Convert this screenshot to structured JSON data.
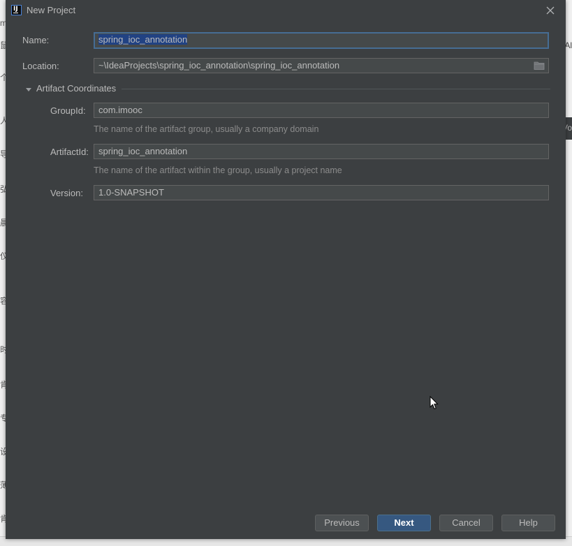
{
  "dialog": {
    "title": "New Project",
    "icon_text": "IJ"
  },
  "form": {
    "name_label": "Name:",
    "name_value": "spring_ioc_annotation",
    "location_label": "Location:",
    "location_value": "~\\IdeaProjects\\spring_ioc_annotation\\spring_ioc_annotation"
  },
  "artifact": {
    "section_title": "Artifact Coordinates",
    "groupid_label": "GroupId:",
    "groupid_value": "com.imooc",
    "groupid_hint": "The name of the artifact group, usually a company domain",
    "artifactid_label": "ArtifactId:",
    "artifactid_value": "spring_ioc_annotation",
    "artifactid_hint": "The name of the artifact within the group, usually a project name",
    "version_label": "Version:",
    "version_value": "1.0-SNAPSHOT"
  },
  "buttons": {
    "previous": "Previous",
    "next": "Next",
    "cancel": "Cancel",
    "help": "Help"
  },
  "background": {
    "left_glyphs": [
      "m",
      "鼠",
      "个",
      "人",
      "导",
      "弘",
      "晨",
      "仪",
      "容",
      "时",
      "肯",
      "专",
      "设",
      "薄",
      "肯"
    ],
    "right_glyphs": [
      "Al",
      "Vo"
    ]
  },
  "colors": {
    "dialog_bg": "#3c3f41",
    "field_bg": "#45494a",
    "focus_border": "#466d94",
    "primary_button": "#365880",
    "selection": "#214283"
  }
}
